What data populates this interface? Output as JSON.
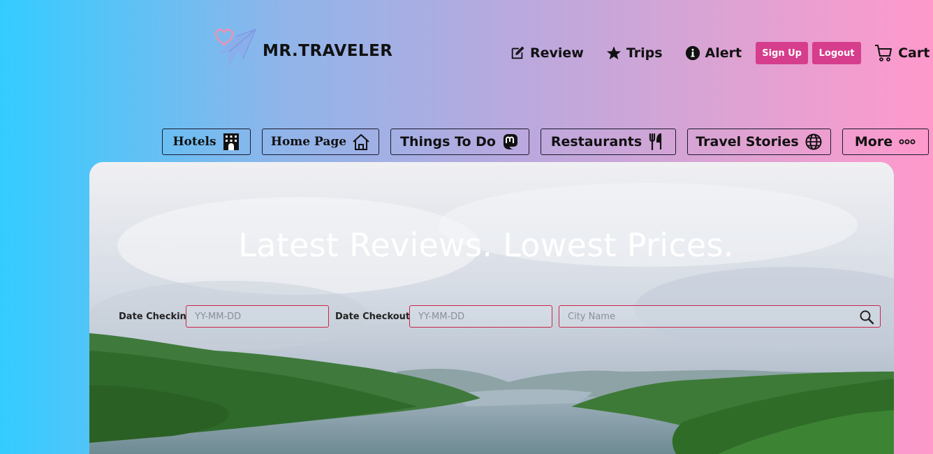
{
  "brand": {
    "name": "MR.TRAVELER",
    "logo_icon": "heart-plane-logo"
  },
  "topnav": {
    "review": {
      "label": "Review",
      "icon": "edit-icon"
    },
    "trips": {
      "label": "Trips",
      "icon": "star-icon"
    },
    "alert": {
      "label": "Alert",
      "icon": "info-icon"
    },
    "signup": "Sign Up",
    "logout": "Logout",
    "cart": {
      "label": "Cart",
      "icon": "cart-icon"
    }
  },
  "categories": [
    {
      "label": "Hotels",
      "icon": "hotel-icon"
    },
    {
      "label": "Home Page",
      "icon": "home-icon"
    },
    {
      "label": "Things To Do",
      "icon": "mastodon-icon"
    },
    {
      "label": "Restaurants",
      "icon": "utensils-icon"
    },
    {
      "label": "Travel Stories",
      "icon": "globe-icon"
    },
    {
      "label": "More",
      "icon": "dots-icon"
    }
  ],
  "hero": {
    "headline": "Latest Reviews. Lowest Prices.",
    "checkin_label": "Date Checkin",
    "checkin_placeholder": "YY-MM-DD",
    "checkout_label": "Date Checkout",
    "checkout_placeholder": "YY-MM-DD",
    "city_placeholder": "City Name"
  },
  "colors": {
    "accent": "#d63d8c",
    "field_border": "#c8264a",
    "gradient_left": "#33ccff",
    "gradient_right": "#ff99cc"
  }
}
